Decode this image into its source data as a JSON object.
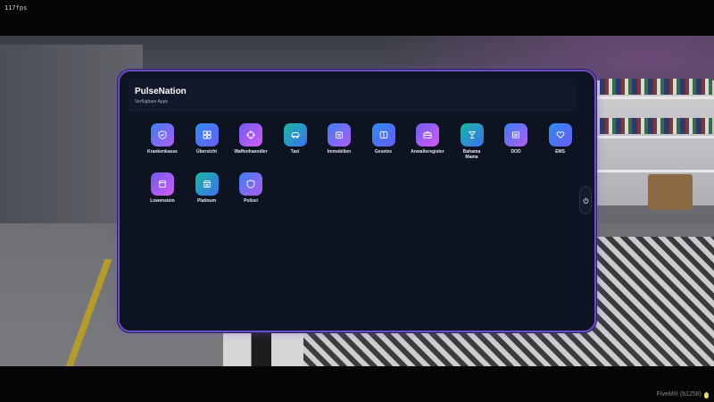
{
  "hud": {
    "fps": "117fps",
    "client_label": "FiveM® (b1258)"
  },
  "tablet": {
    "title": "PulseNation",
    "subtitle": "Verfügbare Apps",
    "accent_color": "#6b4fc7",
    "apps": [
      {
        "label": "Krankenkasse",
        "icon": "shield-icon",
        "gradient": "purple-violet"
      },
      {
        "label": "Übersicht",
        "icon": "dashboard-icon",
        "gradient": "blue-purple"
      },
      {
        "label": "Waffenhaendler",
        "icon": "crosshair-icon",
        "gradient": "purple-pink"
      },
      {
        "label": "Taxi",
        "icon": "taxi-icon",
        "gradient": "green-blue"
      },
      {
        "label": "Immobilien",
        "icon": "building-icon",
        "gradient": "purple-violet"
      },
      {
        "label": "Gesetze",
        "icon": "book-icon",
        "gradient": "blue-purple"
      },
      {
        "label": "Anwaltsregister",
        "icon": "briefcase-icon",
        "gradient": "purple-pink"
      },
      {
        "label": "Bahama Mama",
        "icon": "cocktail-icon",
        "gradient": "green-blue"
      },
      {
        "label": "DOD",
        "icon": "badge-icon",
        "gradient": "purple-violet"
      },
      {
        "label": "EMS",
        "icon": "heart-icon",
        "gradient": "blue-purple"
      },
      {
        "label": "Lowenstein",
        "icon": "store-icon",
        "gradient": "purple-pink"
      },
      {
        "label": "Platinum",
        "icon": "storefront-icon",
        "gradient": "green-blue"
      },
      {
        "label": "Polizei",
        "icon": "police-shield-icon",
        "gradient": "purple-violet"
      }
    ]
  }
}
